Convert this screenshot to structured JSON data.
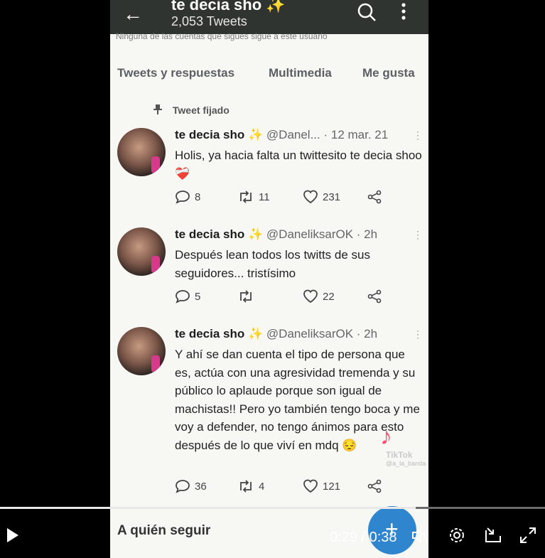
{
  "profile": {
    "name": "te decia sho",
    "name_emoji": "✨",
    "tweet_count": "2,053 Tweets",
    "not_followed_note": "Ninguna de las cuentas que sigues sigue a este usuario"
  },
  "tabs": [
    "Tweets y respuestas",
    "Multimedia",
    "Me gusta"
  ],
  "pinned_label": "Tweet fijado",
  "tweets": [
    {
      "name": "te decia sho",
      "emoji": "✨",
      "handle": "@Danel...",
      "time": "· 12 mar. 21",
      "text": "Holis, ya hacia falta un twittesito te decia shoo",
      "text_emoji": "❤️‍🩹",
      "replies": "8",
      "retweets": "11",
      "likes": "231"
    },
    {
      "name": "te decia sho",
      "emoji": "✨",
      "handle": "@DaneliksarOK",
      "time": "· 2h",
      "text": "Después lean todos los twitts de sus seguidores... tristísimo",
      "text_emoji": "",
      "replies": "5",
      "retweets": "",
      "likes": "22"
    },
    {
      "name": "te decia sho",
      "emoji": "✨",
      "handle": "@DaneliksarOK",
      "time": "· 2h",
      "text": "Y ahí se dan cuenta el tipo de persona que es, actúa con una agresividad tremenda y su público lo aplaude porque son igual de machistas!! Pero yo también tengo boca y me voy a defender, no tengo ánimos para esto después de lo que viví en mdq",
      "text_emoji": "😔",
      "replies": "36",
      "retweets": "4",
      "likes": "121"
    }
  ],
  "who_to_follow": "A quién seguir",
  "watermark": {
    "brand": "TikTok",
    "user": "@a_la_banda"
  },
  "video": {
    "current": "0:29",
    "separator": " / ",
    "duration": "0:38",
    "progress_fraction": 0.763
  },
  "icons": [
    "back-arrow-icon",
    "search-icon",
    "more-vertical-icon",
    "pin-icon",
    "reply-icon",
    "retweet-icon",
    "like-icon",
    "share-icon",
    "play-icon",
    "volume-icon",
    "settings-icon",
    "pip-icon",
    "fullscreen-icon"
  ],
  "colors": {
    "accent": "#2f86cf",
    "sparkle": "#f2c43c",
    "heart": "#d13b4b"
  }
}
